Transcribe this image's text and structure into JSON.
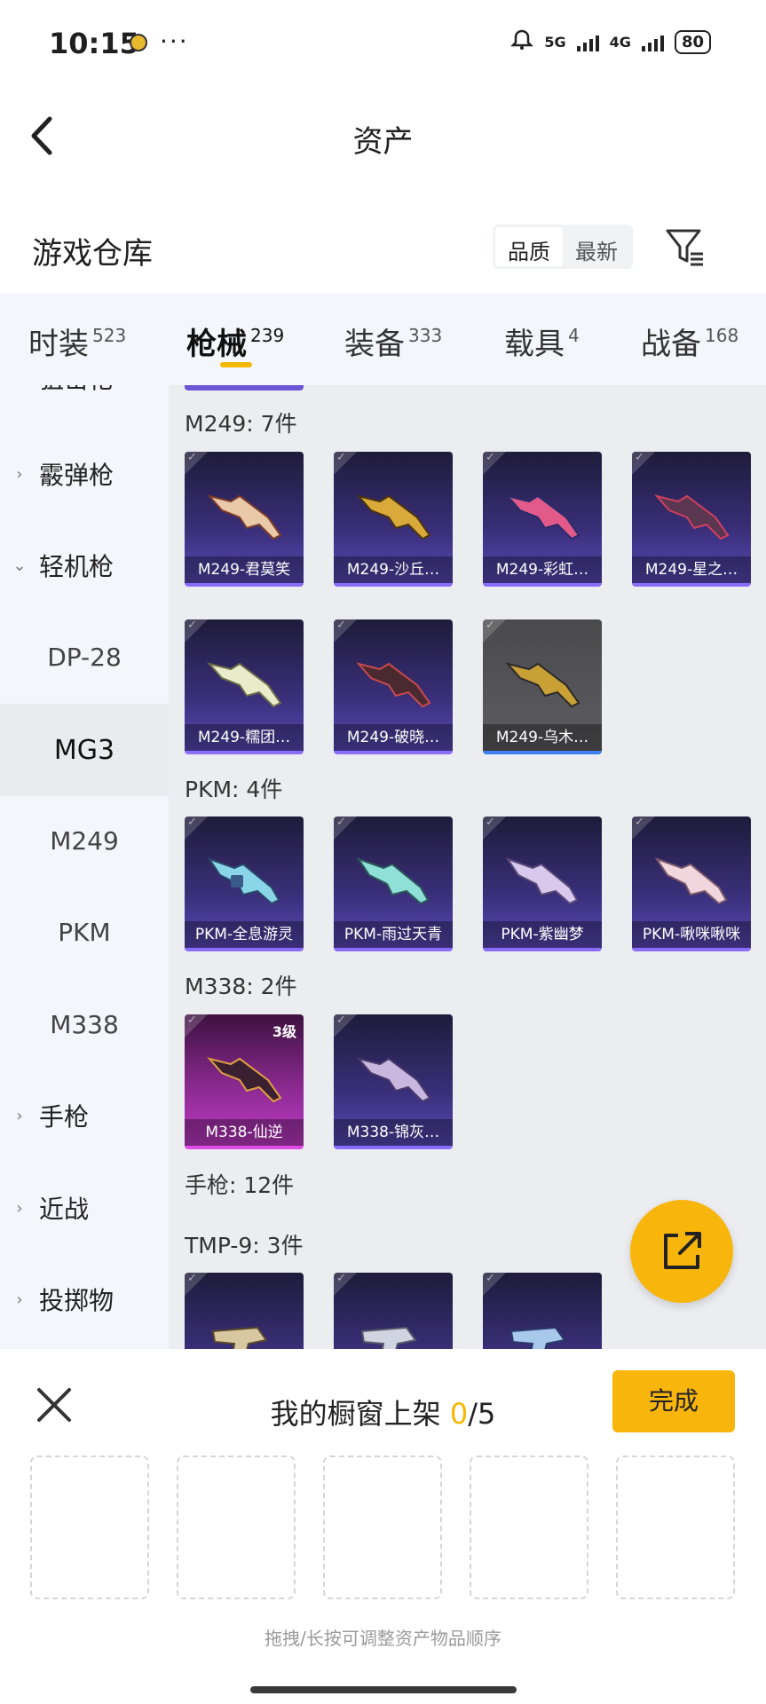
{
  "status": {
    "time": "10:15",
    "dots": "···",
    "net1": "5G",
    "net2": "4G",
    "battery": "80"
  },
  "header": {
    "title": "资产"
  },
  "section": {
    "title": "游戏仓库",
    "sort_quality": "品质",
    "sort_newest": "最新"
  },
  "tabs": [
    {
      "label": "时装",
      "count": "523"
    },
    {
      "label": "枪械",
      "count": "239"
    },
    {
      "label": "装备",
      "count": "333"
    },
    {
      "label": "载具",
      "count": "4"
    },
    {
      "label": "战备",
      "count": "168"
    }
  ],
  "sidebar": {
    "partial_top": "狙击枪",
    "shotgun": "霰弹枪",
    "lmg": "轻机枪",
    "subs": [
      "DP-28",
      "MG3",
      "M249",
      "PKM",
      "M338"
    ],
    "pistol": "手枪",
    "melee": "近战",
    "throwable": "投掷物"
  },
  "groups": {
    "m249": "M249: 7件",
    "pkm": "PKM: 4件",
    "m338": "M338: 2件",
    "pistol": "手枪: 12件",
    "tmp9": "TMP-9: 3件"
  },
  "items": {
    "m249": [
      "M249-君莫笑",
      "M249-沙丘…",
      "M249-彩虹…",
      "M249-星之…",
      "M249-糯团…",
      "M249-破晓…",
      "M249-乌木…"
    ],
    "pkm": [
      "PKM-全息游灵",
      "PKM-雨过天青",
      "PKM-紫幽梦",
      "PKM-啾咪啾咪"
    ],
    "m338": [
      "M338-仙逆",
      "M338-锦灰…"
    ],
    "m338_level": "3级"
  },
  "sheet": {
    "title_prefix": "我的橱窗上架 ",
    "count": "0",
    "total": "/5",
    "done_label": "完成",
    "hint": "拖拽/长按可调整资产物品顺序"
  },
  "colors": {
    "accent": "#f8b50c",
    "card_purple": "#3a2f7a"
  }
}
